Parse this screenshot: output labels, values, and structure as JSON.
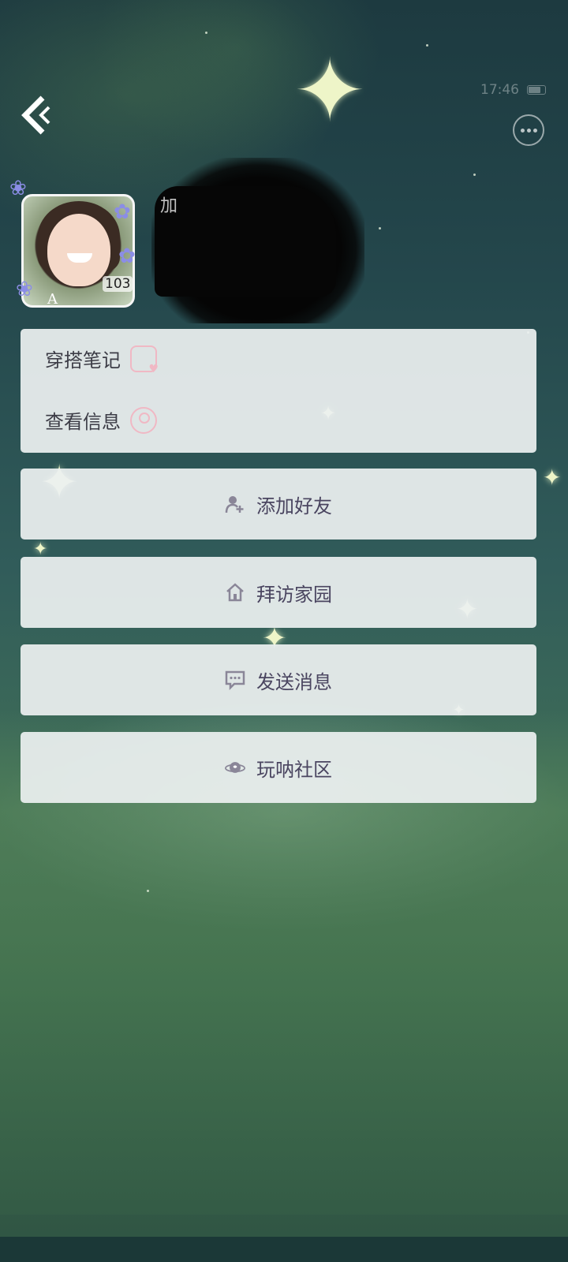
{
  "status_bar": {
    "time": "17:46"
  },
  "profile": {
    "level": "103",
    "name_partial": "加"
  },
  "menu": [
    {
      "label": "穿搭笔记",
      "icon": "outfit-notes-icon"
    },
    {
      "label": "查看信息",
      "icon": "profile-info-icon"
    }
  ],
  "actions": [
    {
      "label": "添加好友",
      "icon": "add-friend-icon"
    },
    {
      "label": "拜访家园",
      "icon": "home-icon"
    },
    {
      "label": "发送消息",
      "icon": "chat-bubble-icon"
    },
    {
      "label": "玩呐社区",
      "icon": "planet-community-icon"
    }
  ],
  "colors": {
    "card_bg": "#ecf0f0",
    "label_text": "#4a4560",
    "accent_pink": "#f0b8c4"
  }
}
